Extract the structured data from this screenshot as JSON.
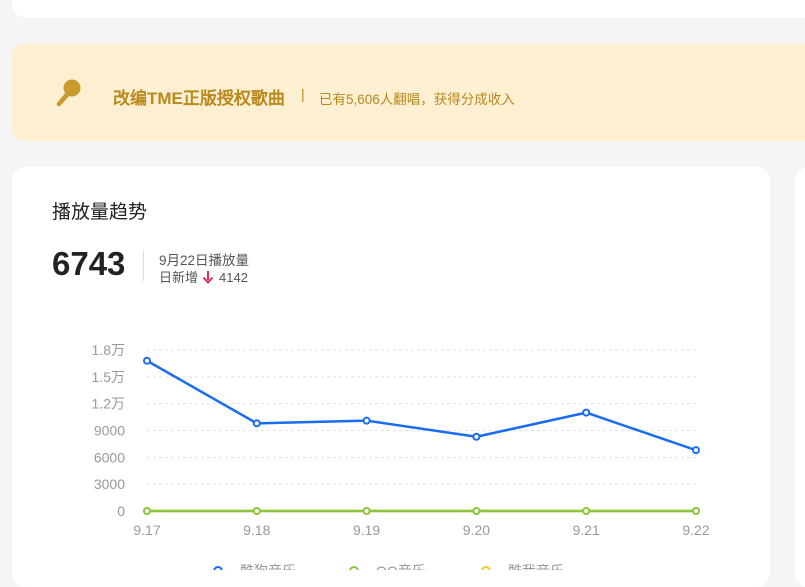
{
  "banner": {
    "title": "改编TME正版授权歌曲",
    "separator": "|",
    "subtitle": "已有5,606人翻唱，获得分成收入",
    "icon": "microphone-icon",
    "color": "#b8891c",
    "background": "#fdefd2"
  },
  "card": {
    "title": "播放量趋势",
    "total": "6743",
    "date_label": "9月22日播放量",
    "increase_label": "日新增",
    "increase_icon": "arrow-down-icon",
    "increase_value": "4142"
  },
  "chart_data": {
    "type": "line",
    "categories": [
      "9.17",
      "9.18",
      "9.19",
      "9.20",
      "9.21",
      "9.22"
    ],
    "y_ticks": [
      {
        "value": 0,
        "label": "0"
      },
      {
        "value": 3000,
        "label": "3000"
      },
      {
        "value": 6000,
        "label": "6000"
      },
      {
        "value": 9000,
        "label": "9000"
      },
      {
        "value": 12000,
        "label": "1.2万"
      },
      {
        "value": 15000,
        "label": "1.5万"
      },
      {
        "value": 18000,
        "label": "1.8万"
      }
    ],
    "ylim": [
      0,
      18000
    ],
    "grid": true,
    "legend_position": "bottom",
    "series": [
      {
        "name": "酷狗音乐",
        "color": "#1a6cf2",
        "values": [
          16800,
          9800,
          10100,
          8300,
          11000,
          6800
        ]
      },
      {
        "name": "QQ音乐",
        "color": "#8cc63f",
        "values": [
          0,
          0,
          0,
          0,
          0,
          0
        ]
      },
      {
        "name": "酷我音乐",
        "color": "#f0cc2e",
        "values": [
          0,
          0,
          0,
          0,
          0,
          0
        ]
      }
    ]
  }
}
